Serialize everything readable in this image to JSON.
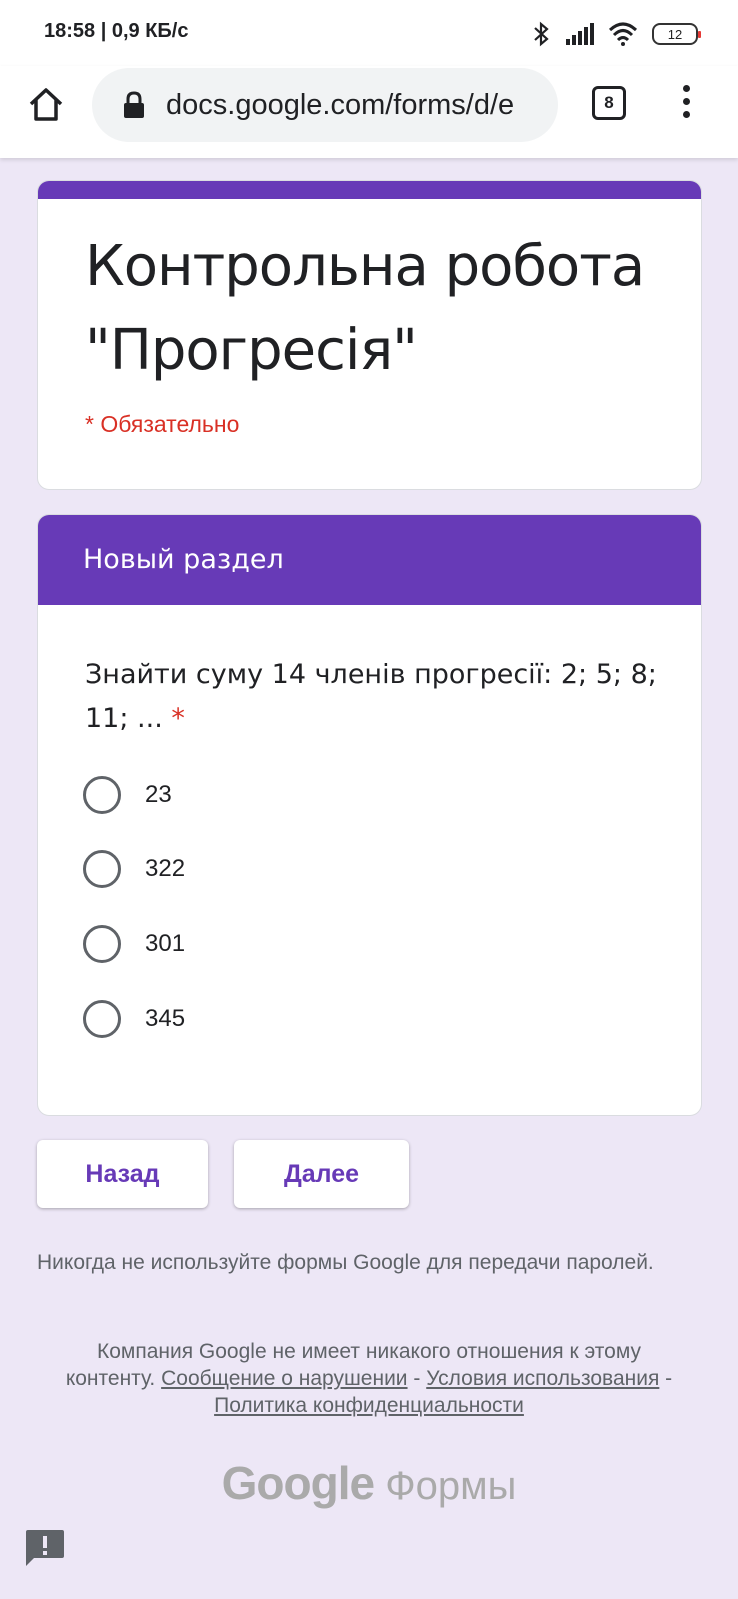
{
  "status_bar": {
    "time_speed": "18:58 | 0,9 КБ/с",
    "battery": "12",
    "icons": [
      "bluetooth-icon",
      "signal-icon",
      "wifi-icon",
      "battery-icon"
    ]
  },
  "browser": {
    "url": "docs.google.com/forms/d/e",
    "tab_count": "8",
    "icons": [
      "home-icon",
      "lock-icon",
      "tabs-icon",
      "more-vert-icon"
    ]
  },
  "form": {
    "title_line1": "Контрольна робота",
    "title_line2": "\"Прогресія\"",
    "required_note": "* Обязательно"
  },
  "section": {
    "title": "Новый раздел",
    "question_text": "Знайти суму 14 членів прогресії: 2; 5; 8; 11; ...",
    "required_mark": "*",
    "options": [
      {
        "label": "23"
      },
      {
        "label": "322"
      },
      {
        "label": "301"
      },
      {
        "label": "345"
      }
    ]
  },
  "buttons": {
    "back": "Назад",
    "next": "Далее"
  },
  "footer": {
    "warning": "Никогда не используйте формы Google для передачи паролей.",
    "disclaimer_text": "Компания Google не имеет никакого отношения к этому контенту.",
    "report_link": "Сообщение о нарушении",
    "terms_link": "Условия использования",
    "privacy_link": "Политика конфиденциальности",
    "separator": "-",
    "brand_google": "Google",
    "brand_forms": "Формы"
  },
  "colors": {
    "accent": "#673ab7",
    "background": "#ede7f6",
    "required": "#d93025"
  }
}
